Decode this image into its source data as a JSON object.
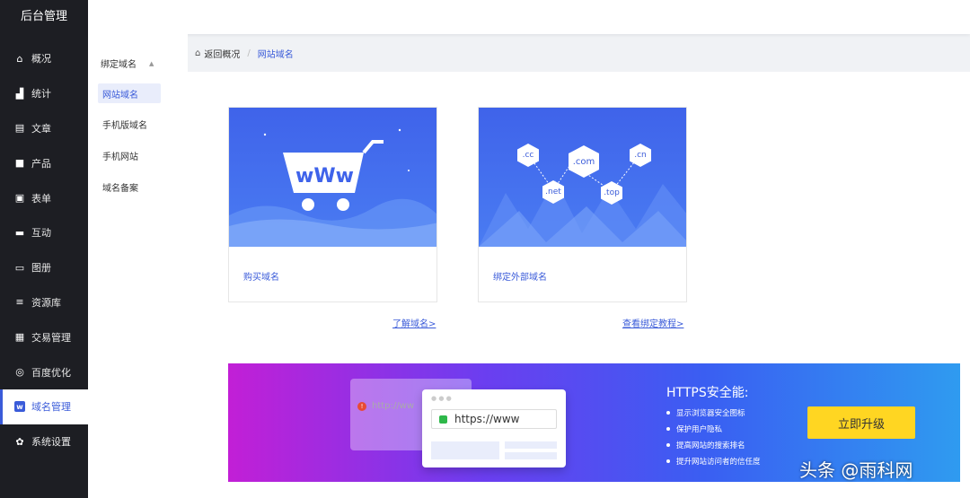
{
  "app": {
    "title": "后台管理"
  },
  "sidebar": {
    "items": [
      {
        "label": "概况",
        "icon": "home-icon"
      },
      {
        "label": "统计",
        "icon": "chart-icon"
      },
      {
        "label": "文章",
        "icon": "article-icon"
      },
      {
        "label": "产品",
        "icon": "product-icon"
      },
      {
        "label": "表单",
        "icon": "form-icon"
      },
      {
        "label": "互动",
        "icon": "chat-icon"
      },
      {
        "label": "图册",
        "icon": "album-icon"
      },
      {
        "label": "资源库",
        "icon": "database-icon"
      },
      {
        "label": "交易管理",
        "icon": "trade-icon"
      },
      {
        "label": "百度优化",
        "icon": "seo-icon"
      },
      {
        "label": "域名管理",
        "icon": "domain-icon",
        "active": true
      },
      {
        "label": "系统设置",
        "icon": "gear-icon"
      }
    ]
  },
  "subnav": {
    "head": "绑定域名",
    "items": [
      {
        "label": "网站域名",
        "active": true
      },
      {
        "label": "手机版域名"
      },
      {
        "label": "手机网站"
      },
      {
        "label": "域名备案"
      }
    ]
  },
  "breadcrumb": {
    "home": "返回概况",
    "sep": "/",
    "current": "网站域名"
  },
  "cards": {
    "buy": {
      "caption": "购买域名",
      "link": "了解域名>",
      "badge": "wWw"
    },
    "bind": {
      "caption": "绑定外部域名",
      "link": "查看绑定教程>",
      "chips": [
        ".cc",
        ".com",
        ".cn",
        ".net",
        ".top"
      ]
    }
  },
  "banner": {
    "title": "HTTPS安全能:",
    "points": [
      "显示浏览器安全图标",
      "保护用户隐私",
      "提高网站的搜索排名",
      "提升网站访问者的信任度"
    ],
    "button": "立即升级",
    "url_front": "https://www",
    "url_back": "http://ww"
  },
  "watermark": "头条 @雨科网",
  "colors": {
    "accent": "#3a5bd9",
    "sidebar": "#1d1e23",
    "button": "#ffd622"
  }
}
